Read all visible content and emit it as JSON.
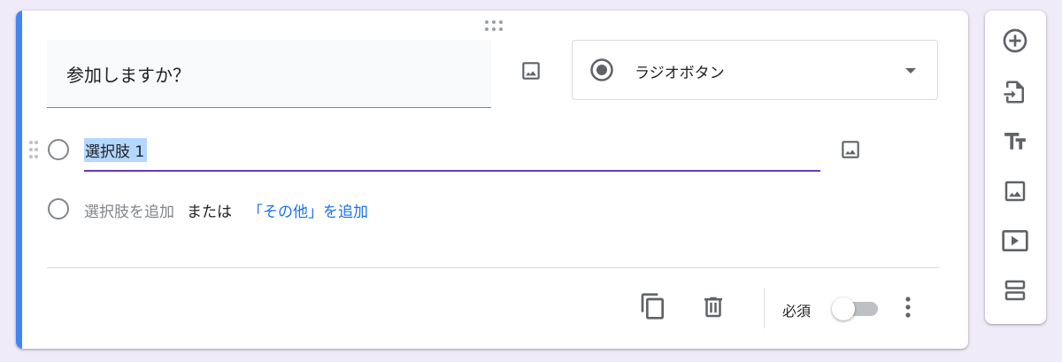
{
  "question": {
    "title": "参加しますか？",
    "type_label": "ラジオボタン"
  },
  "options": [
    {
      "label": "選択肢 1"
    }
  ],
  "add_row": {
    "add_option": "選択肢を追加",
    "or": "または",
    "add_other": "「その他」を追加"
  },
  "footer": {
    "required_label": "必須",
    "required_on": false
  },
  "colors": {
    "accent": "#4285f4",
    "focus": "#673ab7",
    "link": "#1a73e8",
    "background": "#f0ebf8"
  },
  "side_toolbar": {
    "icons": [
      "add-question-icon",
      "import-questions-icon",
      "add-title-icon",
      "add-image-icon",
      "add-video-icon",
      "add-section-icon"
    ]
  }
}
